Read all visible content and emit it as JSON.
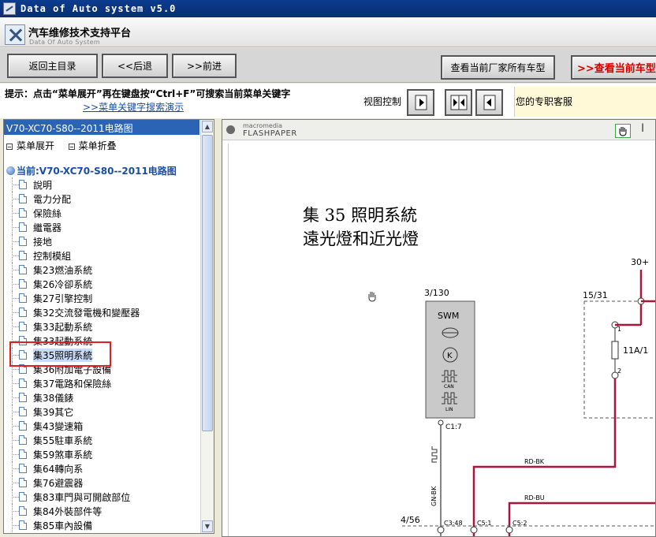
{
  "window": {
    "title": "Data of Auto system v5.0"
  },
  "brand": {
    "title": "汽车维修技术支持平台",
    "subtitle": "Data Of Auto System"
  },
  "toolbar": {
    "home": "返回主目录",
    "back": "<<后退",
    "forward": ">>前进",
    "all_models": "查看当前厂家所有车型",
    "current_model": ">>查看当前车型"
  },
  "hint": {
    "text": "提示：点击“菜单展开”再在键盘按“Ctrl+F”可搜索当前菜单关键字",
    "demo_link": ">>菜单关键字搜索演示",
    "view_control": "视图控制",
    "service": "您的专职客服"
  },
  "tree": {
    "header": "V70-XC70-S80--2011电路图",
    "expand": "菜单展开",
    "collapse": "菜单折叠",
    "current": "当前:V70-XC70-S80--2011电路图",
    "items": [
      "說明",
      "電力分配",
      "保險絲",
      "繼電器",
      "接地",
      "控制模組",
      "集23燃油系統",
      "集26冷卻系統",
      "集27引擎控制",
      "集32交流發電機和變壓器",
      "集33起動系統",
      "集33起動系統",
      "集35照明系統",
      "集36附加電子設備",
      "集37電路和保險絲",
      "集38儀錶",
      "集39其它",
      "集43變速箱",
      "集55駐車系統",
      "集59煞車系統",
      "集64轉向系",
      "集76避震器",
      "集83車門與可開啟部位",
      "集84外裝部件等",
      "集85車內設備"
    ],
    "selected_index": 12
  },
  "viewer": {
    "brand_line1": "macromedia",
    "brand_line2": "FLASHPAPER",
    "title_line1": "集 35 照明系統",
    "title_line2": "遠光燈和近光燈"
  },
  "diagram": {
    "module_id": "3/130",
    "module_name": "SWM",
    "can_label": "CAN",
    "lin_label": "LIN",
    "module_pin": "C1:7",
    "fuse_box": "15/31",
    "fuse_label": "11A/1",
    "fuse_pin_top": "1",
    "fuse_pin_bottom": "2",
    "supply": "30+",
    "wire_rd_bk": "RD-BK",
    "wire_rd_bu": "RD-BU",
    "wire_gn_bk": "GN-BK",
    "connector": "4/56",
    "pin_c3": "C3:48",
    "pin_c5_1": "C5:1",
    "pin_c5_2": "C5:2",
    "colors": {
      "red_wire": "#a8173a",
      "module_fill": "#c9c9c9"
    }
  }
}
